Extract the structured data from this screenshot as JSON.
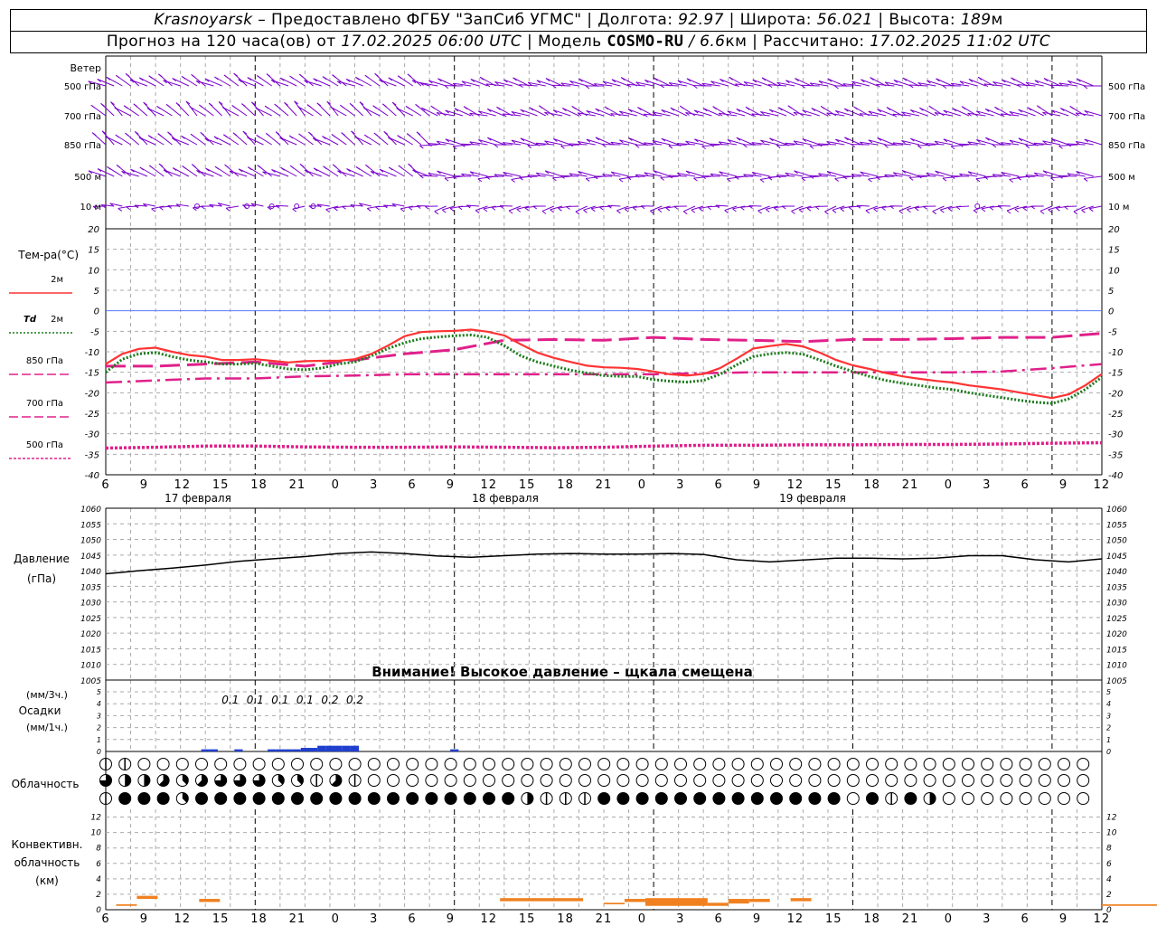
{
  "header": {
    "city": "Krasnoyarsk",
    "dash": "–",
    "provider": "Предоставлено ФГБУ \"ЗапСиб УГМС\"",
    "lon_label": "Долгота:",
    "lon_value": "92.97",
    "lat_label": "Широта:",
    "lat_value": "56.021",
    "alt_label": "Высота:",
    "alt_value": "189",
    "alt_unit": "м",
    "forecast_label": "Прогноз на 120 часа(ов) от",
    "forecast_from": "17.02.2025 06:00 UTC",
    "model_label": "Модель",
    "model_name": "COSMO-RU",
    "model_res": "/ 6.6",
    "model_res_unit": "км",
    "calc_label": "Рассчитано:",
    "calc_value": "17.02.2025 11:02 UTC"
  },
  "wind": {
    "title": "Ветер",
    "levels": [
      "500 гПа",
      "700 гПа",
      "850 гПа",
      "500 м",
      "10 м"
    ]
  },
  "x_axis": {
    "hour_ticks": [
      "6",
      "9",
      "12",
      "15",
      "18",
      "21",
      "0",
      "3",
      "6",
      "9",
      "12",
      "15",
      "18",
      "21",
      "0",
      "3",
      "6",
      "9",
      "12",
      "15",
      "18",
      "21",
      "0",
      "3",
      "6",
      "9",
      "12"
    ],
    "day_labels": [
      "17 февраля",
      "18 февраля",
      "19 февраля"
    ]
  },
  "temperature": {
    "title": "Тем-ра(°C)",
    "legend": [
      {
        "label": "2м",
        "prefix": "",
        "color": "#ff3333",
        "dash": "solid"
      },
      {
        "label": "2м",
        "prefix": "Td",
        "color": "#1a7a1a",
        "dash": "dot"
      },
      {
        "label": "850 гПа",
        "prefix": "",
        "color": "#e0208a",
        "dash": "long"
      },
      {
        "label": "700 гПа",
        "prefix": "",
        "color": "#e0208a",
        "dash": "dashdot"
      },
      {
        "label": "500 гПа",
        "prefix": "",
        "color": "#e0208a",
        "dash": "dense"
      }
    ]
  },
  "pressure": {
    "title": "Давление",
    "unit": "(гПа)",
    "warning": "Внимание! Высокое давление – щкала смещена"
  },
  "precip": {
    "title_top": "(мм/3ч.)",
    "title": "Осадки",
    "title_bottom": "(мм/1ч.)"
  },
  "clouds": {
    "title": "Облачность"
  },
  "convective": {
    "title_1": "Конвективн.",
    "title_2": "облачность",
    "title_3": "(км)"
  },
  "colors": {
    "wind": "#7a00cc",
    "t2m": "#ff3333",
    "td2m": "#1a7a1a",
    "upper": "#e0208a",
    "pressure": "#000000",
    "precip": "#1f3fcf",
    "convective": "#f08020",
    "zero_line": "#5577ff",
    "grid": "#aaaaaa"
  },
  "chart_data": [
    {
      "type": "line",
      "title": "Тем-ра(°C)",
      "x_unit": "hours from 17.02.2025 06:00 UTC",
      "ylim": [
        -40,
        20
      ],
      "y_ticks": [
        -40,
        -35,
        -30,
        -25,
        -20,
        -15,
        -10,
        -5,
        0,
        5,
        10,
        15,
        20
      ],
      "series": [
        {
          "name": "2м",
          "x": [
            0,
            2,
            4,
            6,
            8,
            10,
            12,
            14,
            16,
            18,
            20,
            22,
            24,
            26,
            28,
            30,
            32,
            34,
            36,
            38,
            40,
            42,
            44,
            46,
            48,
            50,
            52,
            54,
            56,
            58,
            60,
            62,
            64,
            66,
            68,
            70,
            72,
            74,
            76,
            78,
            80,
            82,
            84,
            86,
            88,
            90,
            92,
            94,
            96,
            98,
            100,
            102,
            104,
            106,
            108,
            110,
            112,
            114,
            116,
            118,
            120
          ],
          "y": [
            -13,
            -10.5,
            -9.3,
            -9,
            -10,
            -10.8,
            -11.2,
            -12,
            -12,
            -11.8,
            -12.2,
            -12.6,
            -12.3,
            -12.2,
            -12.2,
            -11.8,
            -10.5,
            -8.5,
            -6.2,
            -5.2,
            -5,
            -4.9,
            -4.6,
            -5.1,
            -6,
            -8.2,
            -10.2,
            -11.5,
            -12.5,
            -13.4,
            -13.8,
            -13.9,
            -14.2,
            -14.8,
            -15.5,
            -15.8,
            -15.4,
            -14,
            -11.7,
            -9.2,
            -8.6,
            -8.1,
            -8.7,
            -10.2,
            -12,
            -13.3,
            -14.2,
            -15.2,
            -16,
            -16.6,
            -17.1,
            -17.5,
            -18.2,
            -18.7,
            -19.2,
            -19.9,
            -20.6,
            -21.3,
            -20.4,
            -18.2,
            -15.4
          ]
        },
        {
          "name": "Td 2м",
          "x": [
            0,
            2,
            4,
            6,
            8,
            10,
            12,
            14,
            16,
            18,
            20,
            22,
            24,
            26,
            28,
            30,
            32,
            34,
            36,
            38,
            40,
            42,
            44,
            46,
            48,
            50,
            52,
            54,
            56,
            58,
            60,
            62,
            64,
            66,
            68,
            70,
            72,
            74,
            76,
            78,
            80,
            82,
            84,
            86,
            88,
            90,
            92,
            94,
            96,
            98,
            100,
            102,
            104,
            106,
            108,
            110,
            112,
            114,
            116,
            118,
            120
          ],
          "y": [
            -15,
            -11.8,
            -10.5,
            -10.2,
            -11.2,
            -12,
            -12.5,
            -13,
            -13,
            -12.8,
            -13.5,
            -14.2,
            -14.4,
            -14,
            -13,
            -12.5,
            -11,
            -9.2,
            -7.8,
            -6.8,
            -6.4,
            -6.1,
            -5.9,
            -6.5,
            -8.5,
            -11,
            -12.5,
            -13.5,
            -14.5,
            -15.2,
            -15.8,
            -16,
            -16,
            -16.8,
            -17.2,
            -17.4,
            -17,
            -15.5,
            -13.2,
            -11.2,
            -10.5,
            -10.2,
            -10.6,
            -12,
            -13.5,
            -14.8,
            -16,
            -17,
            -17.7,
            -18.2,
            -18.8,
            -19.2,
            -20,
            -20.6,
            -21.2,
            -21.8,
            -22.3,
            -22.6,
            -21.5,
            -19.2,
            -16.2
          ]
        },
        {
          "name": "850 гПа",
          "x": [
            0,
            6,
            12,
            18,
            24,
            30,
            36,
            42,
            48,
            54,
            60,
            66,
            72,
            78,
            84,
            90,
            96,
            102,
            108,
            114,
            120
          ],
          "y": [
            -13.5,
            -13.5,
            -13,
            -12.5,
            -13.5,
            -12,
            -10.5,
            -9.5,
            -7.2,
            -7,
            -7.2,
            -6.5,
            -7,
            -7.2,
            -7.5,
            -7,
            -7,
            -6.8,
            -6.5,
            -6.5,
            -5.5
          ]
        },
        {
          "name": "700 гПа",
          "x": [
            0,
            6,
            12,
            18,
            24,
            30,
            36,
            42,
            48,
            54,
            60,
            66,
            72,
            78,
            84,
            90,
            96,
            102,
            108,
            114,
            120
          ],
          "y": [
            -17.5,
            -17,
            -16.5,
            -16.5,
            -16,
            -15.8,
            -15.5,
            -15.5,
            -15.5,
            -15.5,
            -15.5,
            -15.5,
            -15.2,
            -15,
            -15,
            -15,
            -15,
            -15,
            -14.8,
            -14,
            -13
          ]
        },
        {
          "name": "500 гПа",
          "x": [
            0,
            6,
            12,
            18,
            24,
            30,
            36,
            42,
            48,
            54,
            60,
            66,
            72,
            78,
            84,
            90,
            96,
            102,
            108,
            114,
            120
          ],
          "y": [
            -33.5,
            -33.3,
            -33,
            -33,
            -33.2,
            -33.3,
            -33.3,
            -33.2,
            -33.3,
            -33.4,
            -33.3,
            -33,
            -32.8,
            -32.8,
            -32.7,
            -32.7,
            -32.6,
            -32.6,
            -32.5,
            -32.3,
            -32.2
          ]
        }
      ]
    },
    {
      "type": "line",
      "title": "Давление",
      "x_unit": "hours from 17.02.2025 06:00 UTC",
      "ylim": [
        1005,
        1060
      ],
      "y_ticks": [
        1005,
        1010,
        1015,
        1020,
        1025,
        1030,
        1035,
        1040,
        1045,
        1050,
        1055,
        1060
      ],
      "series": [
        {
          "name": "Давление",
          "x": [
            0,
            4,
            8,
            12,
            16,
            20,
            24,
            28,
            32,
            36,
            40,
            44,
            48,
            52,
            56,
            60,
            64,
            68,
            72,
            76,
            80,
            84,
            88,
            92,
            96,
            100,
            104,
            108,
            112,
            116,
            120
          ],
          "y": [
            1039,
            1040,
            1040.8,
            1041.8,
            1043,
            1043.8,
            1044.5,
            1045.5,
            1046,
            1045.5,
            1044.7,
            1044.3,
            1044.8,
            1045.3,
            1045.5,
            1045.3,
            1045.3,
            1045.5,
            1045.2,
            1043.5,
            1042.8,
            1043.4,
            1044,
            1044,
            1043.8,
            1044,
            1044.8,
            1044.8,
            1043.5,
            1042.8,
            1043.8
          ]
        }
      ]
    },
    {
      "type": "bar",
      "title": "Осадки",
      "ylim": [
        0,
        5
      ],
      "y_ticks": [
        0,
        1,
        2,
        3,
        4,
        5
      ],
      "labels_3h": [
        {
          "x": 15,
          "text": "0.1"
        },
        {
          "x": 18,
          "text": "0.1"
        },
        {
          "x": 21,
          "text": "0.1"
        },
        {
          "x": 24,
          "text": "0.1"
        },
        {
          "x": 27,
          "text": "0.2"
        },
        {
          "x": 30,
          "text": "0.2"
        }
      ],
      "hourly": [
        {
          "x": 12,
          "mm": 0.03
        },
        {
          "x": 13,
          "mm": 0.03
        },
        {
          "x": 16,
          "mm": 0.03
        },
        {
          "x": 20,
          "mm": 0.03
        },
        {
          "x": 21,
          "mm": 0.03
        },
        {
          "x": 22,
          "mm": 0.03
        },
        {
          "x": 23,
          "mm": 0.03
        },
        {
          "x": 24,
          "mm": 0.05
        },
        {
          "x": 25,
          "mm": 0.05
        },
        {
          "x": 26,
          "mm": 0.08
        },
        {
          "x": 27,
          "mm": 0.08
        },
        {
          "x": 28,
          "mm": 0.08
        },
        {
          "x": 29,
          "mm": 0.08
        },
        {
          "x": 30,
          "mm": 0.08
        },
        {
          "x": 42,
          "mm": 0.03
        }
      ]
    },
    {
      "type": "table",
      "title": "Облачность",
      "rows": 3,
      "columns": 52,
      "coverage_eighths": [
        [
          2,
          2,
          0,
          0,
          0,
          0,
          0,
          0,
          0,
          0,
          0,
          0,
          0,
          0,
          0,
          0,
          0,
          0,
          0,
          0,
          0,
          0,
          0,
          0,
          0,
          0,
          0,
          0,
          0,
          0,
          0,
          0,
          0,
          0,
          0,
          0,
          0,
          0,
          0,
          0,
          0,
          0,
          0,
          0,
          0,
          0,
          0,
          0,
          0,
          0,
          0,
          0
        ],
        [
          6,
          4,
          4,
          5,
          3,
          5,
          6,
          6,
          6,
          3,
          3,
          2,
          5,
          2,
          0,
          0,
          0,
          0,
          0,
          0,
          0,
          0,
          0,
          0,
          0,
          0,
          0,
          0,
          0,
          0,
          0,
          0,
          0,
          0,
          0,
          0,
          0,
          0,
          0,
          0,
          0,
          0,
          0,
          0,
          0,
          0,
          0,
          0,
          0,
          0,
          0,
          0
        ],
        [
          2,
          8,
          8,
          8,
          3,
          8,
          8,
          8,
          8,
          8,
          8,
          8,
          8,
          8,
          8,
          8,
          8,
          8,
          8,
          8,
          8,
          8,
          4,
          2,
          2,
          2,
          8,
          8,
          8,
          8,
          8,
          8,
          8,
          8,
          8,
          8,
          8,
          8,
          8,
          0,
          8,
          2,
          8,
          4,
          0,
          0,
          0,
          0,
          0,
          0,
          0,
          0
        ]
      ]
    },
    {
      "type": "bar",
      "title": "Конвективн. облачность (км)",
      "ylim": [
        0,
        13
      ],
      "y_ticks": [
        0,
        2,
        4,
        6,
        8,
        10,
        12
      ],
      "segments": [
        {
          "x0": 0.5,
          "x1": 1.5,
          "base": 0.5,
          "top": 0.7
        },
        {
          "x0": 1.5,
          "x1": 2.5,
          "base": 1.4,
          "top": 1.8
        },
        {
          "x0": 4.5,
          "x1": 5.5,
          "base": 1.0,
          "top": 1.4
        },
        {
          "x0": 19,
          "x1": 23,
          "base": 1.1,
          "top": 1.5
        },
        {
          "x0": 24,
          "x1": 25,
          "base": 0.7,
          "top": 0.9
        },
        {
          "x0": 25,
          "x1": 26,
          "base": 1.0,
          "top": 1.4
        },
        {
          "x0": 26,
          "x1": 29,
          "base": 0.5,
          "top": 1.5
        },
        {
          "x0": 29,
          "x1": 30,
          "base": 0.5,
          "top": 0.9
        },
        {
          "x0": 30,
          "x1": 31,
          "base": 0.8,
          "top": 1.4
        },
        {
          "x0": 31,
          "x1": 32,
          "base": 1.0,
          "top": 1.4
        },
        {
          "x0": 33,
          "x1": 34,
          "base": 1.1,
          "top": 1.5
        },
        {
          "x0": 48,
          "x1": 51,
          "base": 0.5,
          "top": 0.7
        },
        {
          "x0": 51,
          "x1": 54,
          "base": 0.7,
          "top": 0.9
        }
      ]
    }
  ]
}
